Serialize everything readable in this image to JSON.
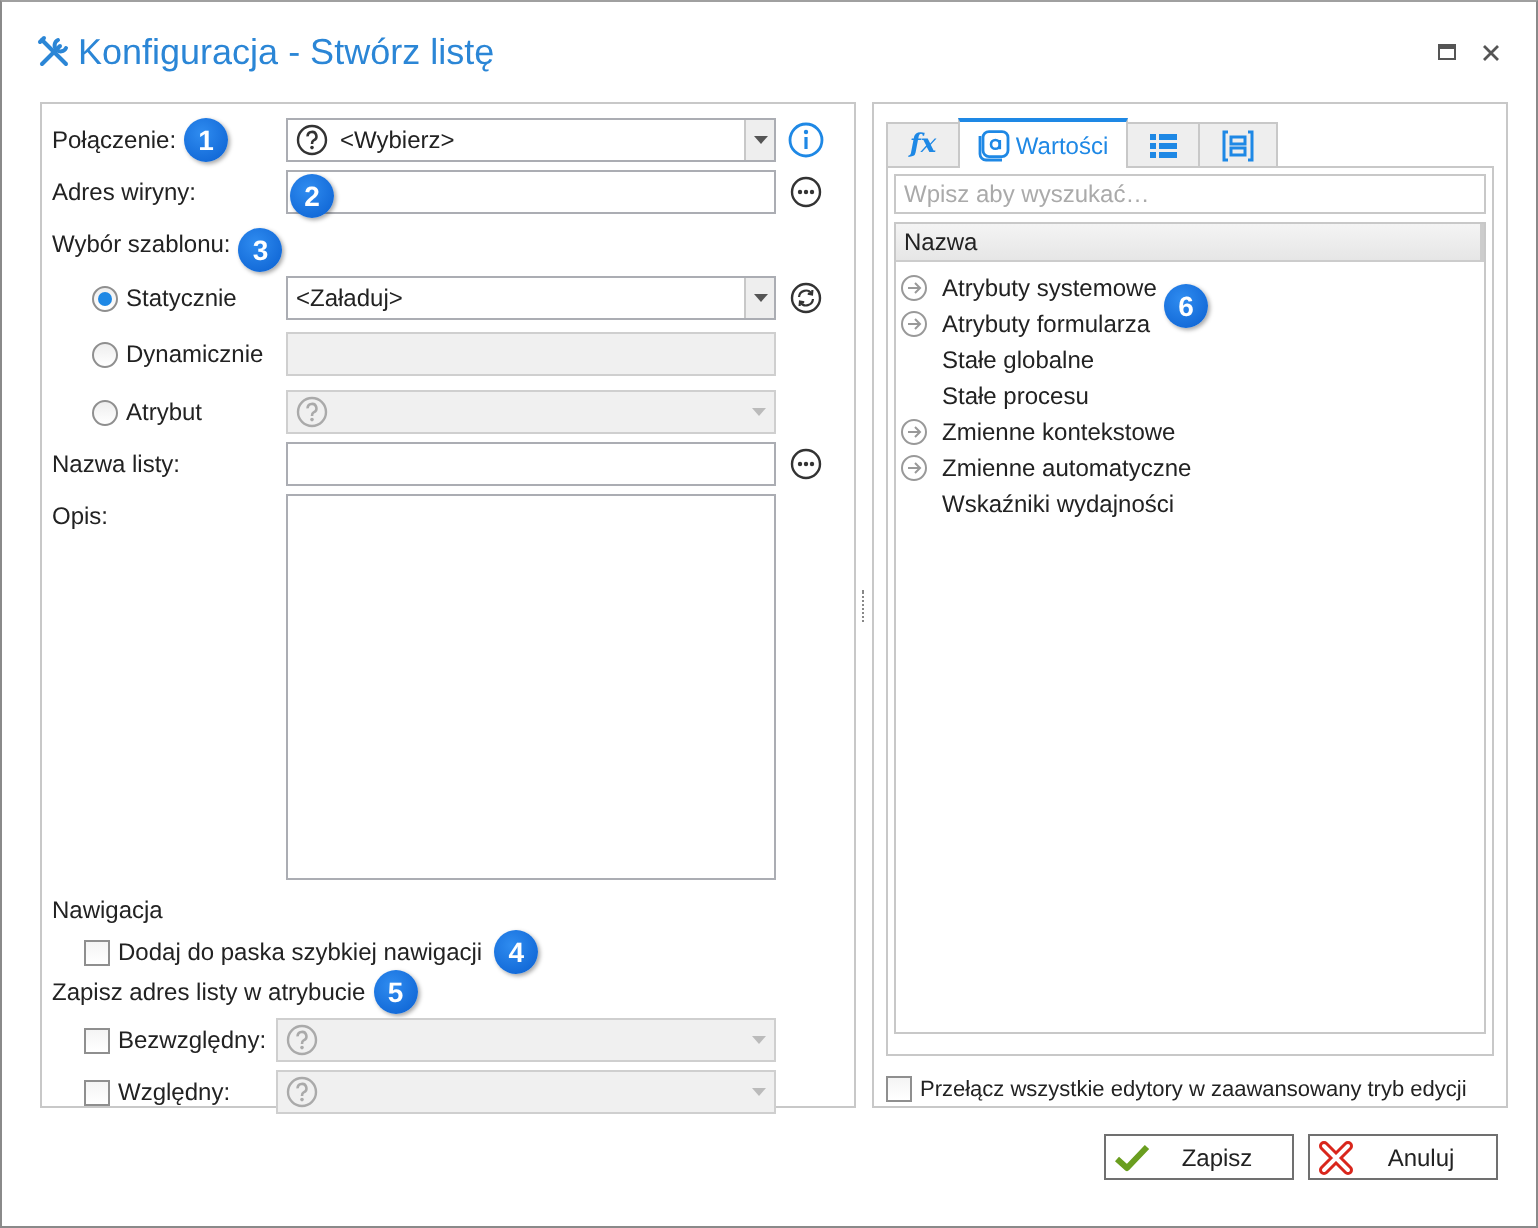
{
  "window": {
    "title": "Konfiguracja - Stwórz listę"
  },
  "form": {
    "connection": {
      "label": "Połączenie:",
      "badge": "1",
      "value": "<Wybierz>"
    },
    "site_address": {
      "label": "Adres wiryny:",
      "badge": "2"
    },
    "template": {
      "label": "Wybór szablonu:",
      "badge": "3",
      "options": [
        {
          "label": "Statycznie",
          "selected": true,
          "kind": "dropdown",
          "value": "<Załaduj>",
          "disabled": false
        },
        {
          "label": "Dynamicznie",
          "selected": false,
          "kind": "text",
          "disabled": true
        },
        {
          "label": "Atrybut",
          "selected": false,
          "kind": "attribute",
          "disabled": true
        }
      ]
    },
    "list_name": {
      "label": "Nazwa listy:"
    },
    "description": {
      "label": "Opis:"
    },
    "navigation": {
      "heading": "Nawigacja",
      "label": "Dodaj do paska szybkiej nawigacji",
      "checked": false,
      "badge": "4"
    },
    "save_address": {
      "heading": "Zapisz adres listy w atrybucie",
      "badge": "5",
      "options": [
        {
          "label": "Bezwzględny:",
          "checked": false,
          "disabled": true
        },
        {
          "label": "Względny:",
          "checked": false,
          "disabled": true
        }
      ]
    }
  },
  "values_panel": {
    "tabs": [
      {
        "kind": "fx",
        "label": "fx",
        "selected": false
      },
      {
        "kind": "values",
        "label": "Wartości",
        "selected": true
      },
      {
        "kind": "list",
        "selected": false
      },
      {
        "kind": "frame",
        "selected": false
      }
    ],
    "search": {
      "placeholder": "Wpisz aby wyszukać…"
    },
    "column": "Nazwa",
    "badge": "6",
    "items": [
      {
        "label": "Atrybuty systemowe",
        "expandable": true
      },
      {
        "label": "Atrybuty formularza",
        "expandable": true
      },
      {
        "label": "Stałe globalne",
        "expandable": false
      },
      {
        "label": "Stałe procesu",
        "expandable": false
      },
      {
        "label": "Zmienne kontekstowe",
        "expandable": true
      },
      {
        "label": "Zmienne automatyczne",
        "expandable": true
      },
      {
        "label": "Wskaźniki wydajności",
        "expandable": false
      }
    ],
    "advanced_mode": {
      "label": "Przełącz wszystkie edytory w zaawansowany tryb edycji",
      "checked": false
    }
  },
  "buttons": [
    {
      "kind": "save",
      "label": "Zapisz"
    },
    {
      "kind": "cancel",
      "label": "Anuluj"
    }
  ]
}
